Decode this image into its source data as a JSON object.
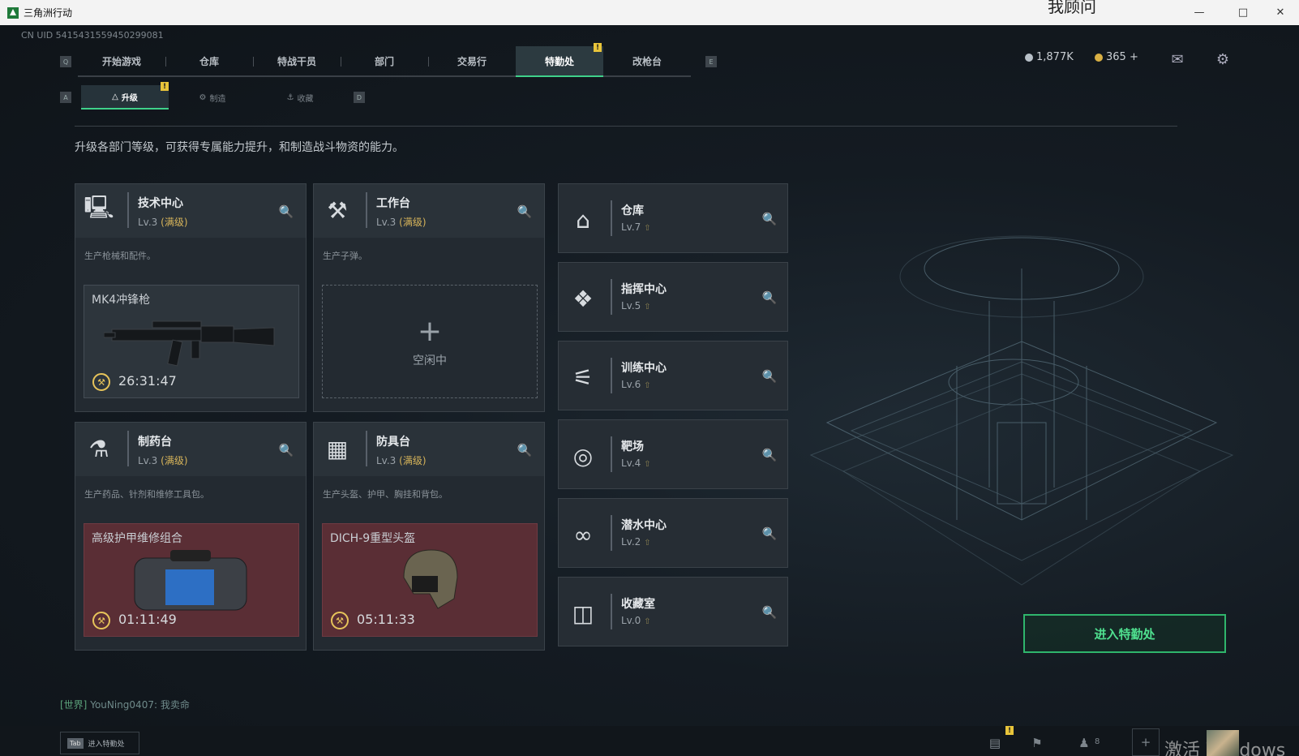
{
  "window": {
    "title": "三角洲行动",
    "overflow_text": "我顾问"
  },
  "uid": "CN UID 5415431559450299081",
  "tabs": {
    "key_left": "Q",
    "key_right": "E",
    "items": [
      {
        "label": "开始游戏"
      },
      {
        "label": "仓库"
      },
      {
        "label": "特战干员"
      },
      {
        "label": "部门"
      },
      {
        "label": "交易行"
      },
      {
        "label": "特勤处",
        "active": true,
        "badge": "!"
      },
      {
        "label": "改枪台"
      }
    ]
  },
  "currency": {
    "silver": "1,877K",
    "gold": "365 +"
  },
  "subtabs": {
    "key_left": "A",
    "key_right": "D",
    "items": [
      {
        "label": "升级",
        "active": true,
        "badge": "!"
      },
      {
        "label": "制造"
      },
      {
        "label": "收藏"
      }
    ]
  },
  "description": "升级各部门等级，可获得专属能力提升，和制造战斗物资的能力。",
  "stations": [
    {
      "name": "技术中心",
      "level": "Lv.3",
      "max": "(满级)",
      "desc": "生产枪械和配件。",
      "item": "MK4冲锋枪",
      "timer": "26:31:47",
      "icon": "monitor-icon"
    },
    {
      "name": "工作台",
      "level": "Lv.3",
      "max": "(满级)",
      "desc": "生产子弹。",
      "idle": "空闲中",
      "plus": "+",
      "icon": "tools-icon"
    },
    {
      "name": "制药台",
      "level": "Lv.3",
      "max": "(满级)",
      "desc": "生产药品、针剂和维修工具包。",
      "item": "高级护甲维修组合",
      "timer": "01:11:49",
      "icon": "pharma-icon"
    },
    {
      "name": "防具台",
      "level": "Lv.3",
      "max": "(满级)",
      "desc": "生产头盔、护甲、胸挂和背包。",
      "item": "DICH-9重型头盔",
      "timer": "05:11:33",
      "icon": "armor-icon"
    }
  ],
  "side_stations": [
    {
      "name": "仓库",
      "level": "Lv.7",
      "icon": "warehouse-icon"
    },
    {
      "name": "指挥中心",
      "level": "Lv.5",
      "icon": "command-icon"
    },
    {
      "name": "训练中心",
      "level": "Lv.6",
      "icon": "dumbbell-icon"
    },
    {
      "name": "靶场",
      "level": "Lv.4",
      "icon": "target-icon"
    },
    {
      "name": "潜水中心",
      "level": "Lv.2",
      "icon": "dive-icon"
    },
    {
      "name": "收藏室",
      "level": "Lv.0",
      "icon": "collection-icon"
    }
  ],
  "enter_button": "进入特勤处",
  "chat": {
    "channel": "[世界]",
    "user": "YouNing0407:",
    "message": "我卖命"
  },
  "bottom": {
    "tab_key": "Tab",
    "tab_label": "进入特勤处",
    "friends": "8",
    "watermark": "激活 Windows"
  }
}
